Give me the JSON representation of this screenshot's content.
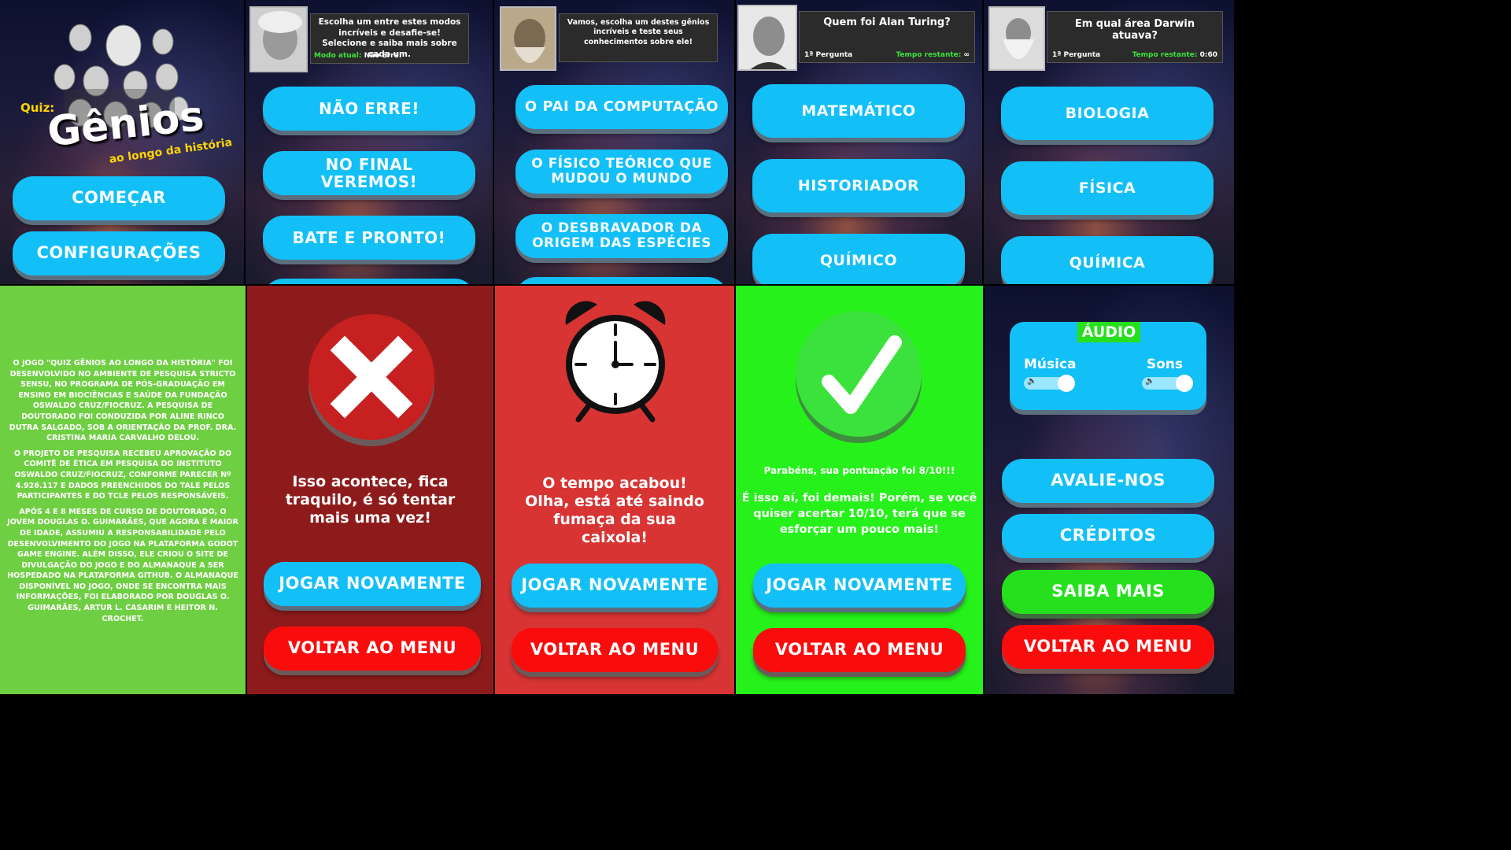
{
  "menu": {
    "quiz_label": "Quiz:",
    "title": "Gênios",
    "subtitle": "ao longo da história",
    "start_button": "COMEÇAR",
    "settings_button": "CONFIGURAÇÕES"
  },
  "modes": {
    "prompt": "Escolha um entre estes modos incríveis e desafie-se! Selecione e saiba mais sobre cada um.",
    "current_mode_label": "Modo atual:",
    "current_mode_value": "Não Erre!",
    "options": [
      "NÃO ERRE!",
      "NO FINAL VEREMOS!",
      "BATE E PRONTO!"
    ]
  },
  "genius_select": {
    "prompt": "Vamos, escolha um destes gênios incríveis e teste seus conhecimentos sobre ele!",
    "options": [
      "O PAI DA COMPUTAÇÃO",
      "O FÍSICO TEÓRICO QUE MUDOU O MUNDO",
      "O DESBRAVADOR DA ORIGEM DAS ESPÉCIES"
    ]
  },
  "question_turing": {
    "question": "Quem foi Alan Turing?",
    "counter": "1ª Pergunta",
    "time_label": "Tempo restante:",
    "time_value": "∞",
    "answers": [
      "MATEMÁTICO",
      "HISTORIADOR",
      "QUÍMICO"
    ]
  },
  "question_darwin": {
    "question": "Em qual área Darwin atuava?",
    "counter": "1ª Pergunta",
    "time_label": "Tempo restante:",
    "time_value": "0:60",
    "answers": [
      "BIOLOGIA",
      "FÍSICA",
      "QUÍMICA"
    ]
  },
  "about": {
    "paragraphs": [
      "O JOGO \"QUIZ GÊNIOS AO LONGO DA HISTÓRIA\" FOI DESENVOLVIDO NO AMBIENTE DE PESQUISA STRICTO SENSU, NO PROGRAMA DE PÓS-GRADUAÇÃO EM ENSINO EM BIOCIÊNCIAS E SAÚDE DA FUNDAÇÃO OSWALDO CRUZ/FIOCRUZ. A PESQUISA DE DOUTORADO FOI CONDUZIDA POR ALINE RINCO DUTRA SALGADO, SOB A ORIENTAÇÃO DA PROF. DRA. CRISTINA MARIA CARVALHO DELOU.",
      "O PROJETO DE PESQUISA RECEBEU APROVAÇÃO DO COMITÊ DE ÉTICA EM PESQUISA DO INSTITUTO OSWALDO CRUZ/FIOCRUZ, CONFORME PARECER Nº 4.926.117 E DADOS PREENCHIDOS DO TALE PELOS PARTICIPANTES E DO TCLE PELOS RESPONSÁVEIS.",
      "APÓS 4 E 8 MESES DE CURSO DE DOUTORADO, O JOVEM DOUGLAS O. GUIMARÃES, QUE AGORA É MAIOR DE IDADE, ASSUMIU A RESPONSABILIDADE PELO DESENVOLVIMENTO DO JOGO NA PLATAFORMA GODOT GAME ENGINE. ALÉM DISSO, ELE CRIOU O SITE DE DIVULGAÇÃO DO JOGO E DO ALMANAQUE A SER HOSPEDADO NA PLATAFORMA GITHUB. O ALMANAQUE DISPONÍVEL NO JOGO, ONDE SE ENCONTRA MAIS INFORMAÇÕES, FOI ELABORADO POR DOUGLAS O. GUIMARÃES, ARTUR L. CASARIM E HEITOR N. CROCHET."
    ]
  },
  "wrong": {
    "message": "Isso acontece, fica traquilo, é só tentar mais uma vez!",
    "play_again": "JOGAR NOVAMENTE",
    "back_menu": "VOLTAR AO MENU"
  },
  "timeout": {
    "message": "O tempo acabou! Olha, está até saindo fumaça da sua caixola!",
    "play_again": "JOGAR NOVAMENTE",
    "back_menu": "VOLTAR AO MENU"
  },
  "success": {
    "score_line": "Parabéns, sua pontuação foi 8/10!!!",
    "message": "É isso aí, foi demais! Porém, se você quiser acertar 10/10, terá que se esforçar um pouco mais!",
    "play_again": "JOGAR NOVAMENTE",
    "back_menu": "VOLTAR AO MENU"
  },
  "settings": {
    "audio_title": "ÁUDIO",
    "music_label": "Música",
    "sounds_label": "Sons",
    "music_level": 0.85,
    "sounds_level": 0.85,
    "rate_button": "AVALIE-NOS",
    "credits_button": "CRÉDITOS",
    "learn_more_button": "SAIBA MAIS",
    "back_menu": "VOLTAR AO MENU"
  },
  "colors": {
    "button_blue": "#12bff7",
    "button_red": "#fb0c0c",
    "button_green": "#26e01e",
    "about_bg": "#6fcf43",
    "wrong_bg": "#8e1b1b",
    "timeout_bg": "#d83434",
    "success_bg": "#26f11a"
  },
  "icons": {
    "wrong": "x-mark-icon",
    "timeout": "alarm-clock-icon",
    "success": "checkmark-icon",
    "volume": "speaker-icon"
  }
}
